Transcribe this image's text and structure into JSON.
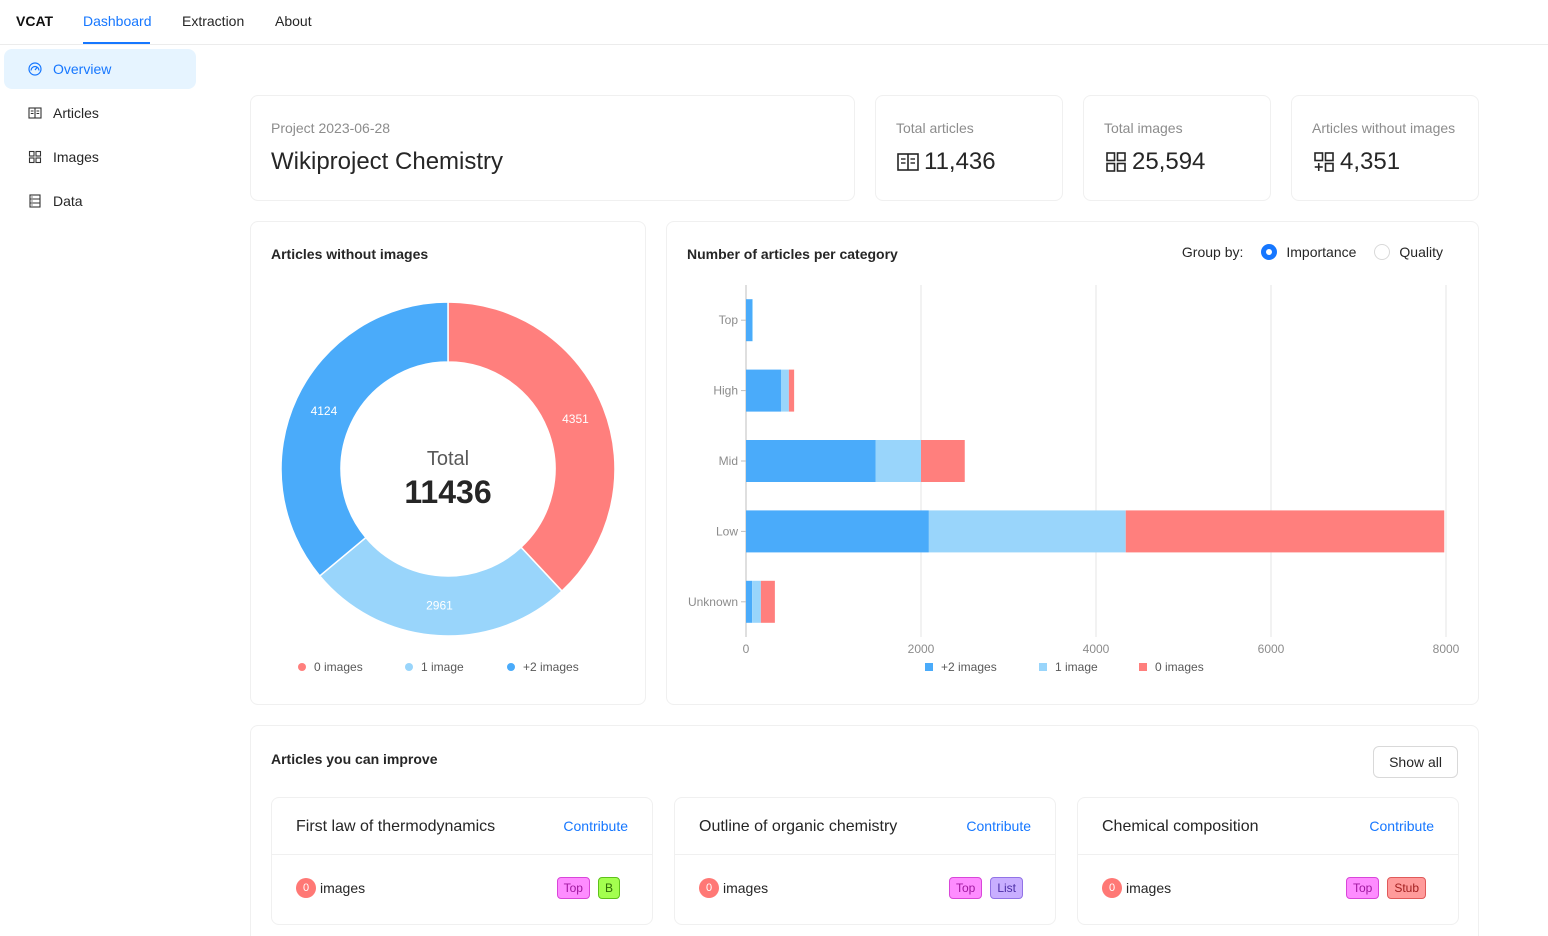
{
  "nav": {
    "brand": "VCAT",
    "tabs": [
      {
        "label": "Dashboard",
        "active": true
      },
      {
        "label": "Extraction",
        "active": false
      },
      {
        "label": "About",
        "active": false
      }
    ]
  },
  "sidebar": {
    "items": [
      {
        "label": "Overview",
        "icon": "dashboard-icon",
        "active": true
      },
      {
        "label": "Articles",
        "icon": "book-icon",
        "active": false
      },
      {
        "label": "Images",
        "icon": "grid-icon",
        "active": false
      },
      {
        "label": "Data",
        "icon": "database-icon",
        "active": false
      }
    ]
  },
  "project": {
    "date_label": "Project 2023-06-28",
    "name": "Wikiproject Chemistry"
  },
  "stats": [
    {
      "label": "Total articles",
      "value": "11,436",
      "icon": "book-icon"
    },
    {
      "label": "Total images",
      "value": "25,594",
      "icon": "grid-icon"
    },
    {
      "label": "Articles without images",
      "value": "4,351",
      "icon": "grid-add-icon"
    }
  ],
  "donut": {
    "title": "Articles without images",
    "center_label": "Total",
    "center_value": "11436",
    "legend": [
      {
        "label": "0 images",
        "color": "#ff7f7d"
      },
      {
        "label": "1 image",
        "color": "#99d5fb"
      },
      {
        "label": "+2 images",
        "color": "#4aabfa"
      }
    ]
  },
  "bar": {
    "title": "Number of articles per category",
    "group_by_label": "Group by:",
    "options": [
      {
        "label": "Importance",
        "checked": true
      },
      {
        "label": "Quality",
        "checked": false
      }
    ],
    "legend": [
      {
        "label": "+2 images",
        "color": "#4aabfa"
      },
      {
        "label": "1 image",
        "color": "#99d5fb"
      },
      {
        "label": "0 images",
        "color": "#ff7f7d"
      }
    ]
  },
  "chart_data": [
    {
      "type": "pie",
      "title": "Articles without images",
      "labels": [
        "0 images",
        "1 image",
        "+2 images"
      ],
      "values": [
        4351,
        2961,
        4124
      ],
      "colors": [
        "#ff7f7d",
        "#99d5fb",
        "#4aabfa"
      ],
      "total": 11436
    },
    {
      "type": "bar",
      "orientation": "horizontal",
      "stacked": true,
      "title": "Number of articles per category",
      "categories": [
        "Top",
        "High",
        "Mid",
        "Low",
        "Unknown"
      ],
      "series": [
        {
          "name": "+2 images",
          "color": "#4aabfa",
          "values": [
            70,
            400,
            1480,
            2090,
            70
          ]
        },
        {
          "name": "1 image",
          "color": "#99d5fb",
          "values": [
            10,
            90,
            520,
            2250,
            100
          ]
        },
        {
          "name": "0 images",
          "color": "#ff7f7d",
          "values": [
            0,
            60,
            500,
            3640,
            160
          ]
        }
      ],
      "xlim": [
        0,
        8000
      ],
      "xticks": [
        "0",
        "2000",
        "4000",
        "6000",
        "8000"
      ],
      "legend": "bottom"
    }
  ],
  "improve": {
    "title": "Articles you can improve",
    "show_all": "Show all",
    "articles": [
      {
        "title": "First law of thermodynamics",
        "link": "Contribute",
        "images": "0",
        "images_label": "images",
        "tags": [
          {
            "label": "Top",
            "bg": "#fe8cff",
            "border": "#d946d9",
            "color": "#a0179f"
          },
          {
            "label": "B",
            "bg": "#a3ff4f",
            "border": "#5ec21a",
            "color": "#2f6b07"
          }
        ]
      },
      {
        "title": "Outline of organic chemistry",
        "link": "Contribute",
        "images": "0",
        "images_label": "images",
        "tags": [
          {
            "label": "Top",
            "bg": "#fe8cff",
            "border": "#d946d9",
            "color": "#a0179f"
          },
          {
            "label": "List",
            "bg": "#c8aeff",
            "border": "#9273e6",
            "color": "#4b2da6"
          }
        ]
      },
      {
        "title": "Chemical composition",
        "link": "Contribute",
        "images": "0",
        "images_label": "images",
        "tags": [
          {
            "label": "Top",
            "bg": "#fe8cff",
            "border": "#d946d9",
            "color": "#a0179f"
          },
          {
            "label": "Stub",
            "bg": "#ff9b9b",
            "border": "#e05a5a",
            "color": "#a32020"
          }
        ]
      }
    ]
  }
}
